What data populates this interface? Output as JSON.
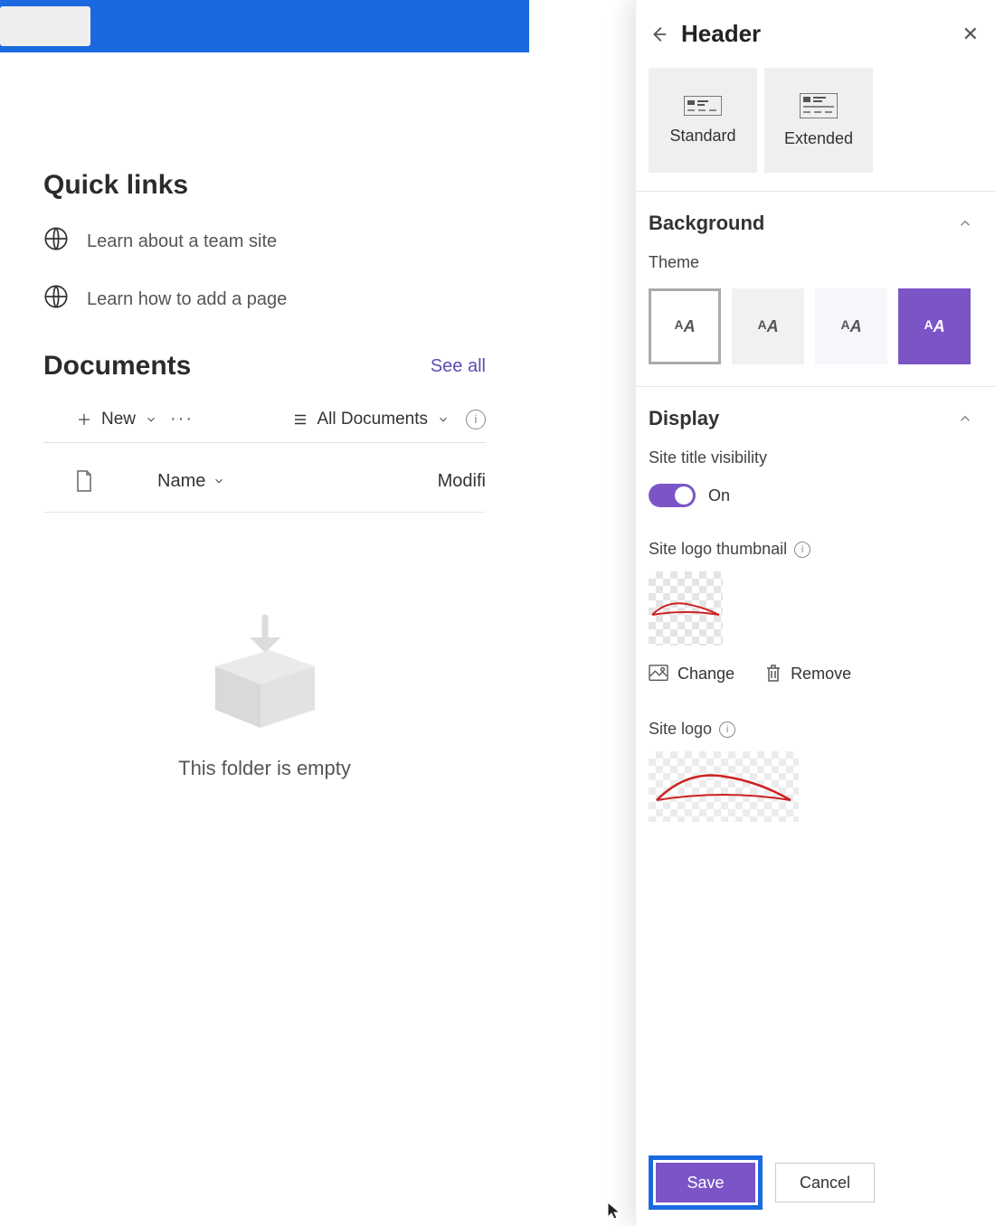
{
  "quicklinks": {
    "title": "Quick links",
    "items": [
      {
        "label": "Learn about a team site"
      },
      {
        "label": "Learn how to add a page"
      }
    ]
  },
  "documents": {
    "title": "Documents",
    "see_all": "See all",
    "new_label": "New",
    "alldocs_label": "All Documents",
    "col_name": "Name",
    "col_modified": "Modifi",
    "empty_text": "This folder is empty"
  },
  "panel": {
    "title": "Header",
    "layout_standard": "Standard",
    "layout_extended": "Extended",
    "background": {
      "title": "Background",
      "theme_label": "Theme"
    },
    "display": {
      "title": "Display",
      "site_title_visibility": "Site title visibility",
      "toggle_state": "On",
      "site_logo_thumbnail": "Site logo thumbnail",
      "change_label": "Change",
      "remove_label": "Remove",
      "site_logo": "Site logo"
    },
    "footer": {
      "save": "Save",
      "cancel": "Cancel"
    }
  },
  "colors": {
    "primary": "#7b55c6",
    "accent_blue": "#1a69e0"
  }
}
